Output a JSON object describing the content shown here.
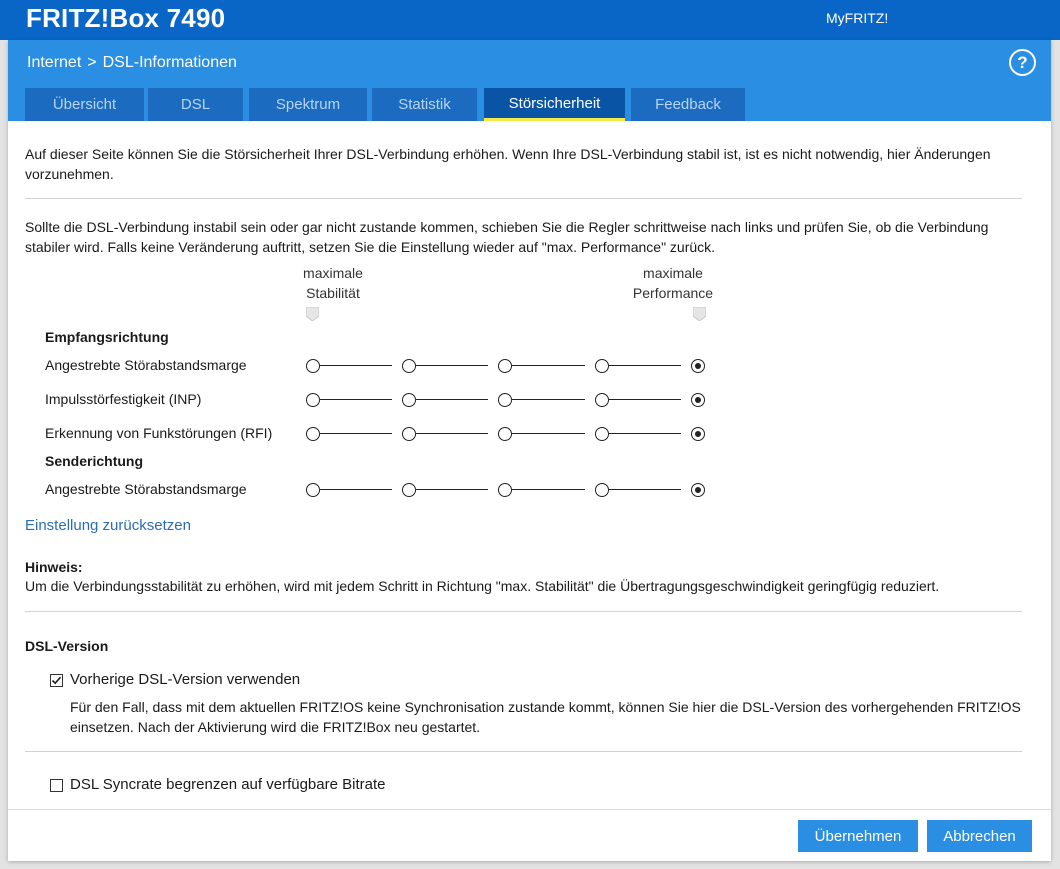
{
  "topbar": {
    "brand": "FRITZ!Box 7490",
    "myfritz": "MyFRITZ!"
  },
  "breadcrumb": {
    "parent": "Internet",
    "separator": ">",
    "current": "DSL-Informationen"
  },
  "help": {
    "icon": "help-icon",
    "glyph": "?"
  },
  "tabs": [
    {
      "label": "Übersicht",
      "active": false
    },
    {
      "label": "DSL",
      "active": false
    },
    {
      "label": "Spektrum",
      "active": false
    },
    {
      "label": "Statistik",
      "active": false
    },
    {
      "label": "Störsicherheit",
      "active": true
    },
    {
      "label": "Feedback",
      "active": false
    }
  ],
  "intro": {
    "text": "Auf dieser Seite können Sie die Störsicherheit Ihrer DSL-Verbindung erhöhen. Wenn Ihre DSL-Verbindung stabil ist, ist es nicht notwendig, hier Änderungen vorzunehmen."
  },
  "instructions": {
    "text": "Sollte die DSL-Verbindung instabil sein oder gar nicht zustande kommen, schieben Sie die Regler schrittweise nach links und prüfen Sie, ob die Verbindung stabiler wird. Falls keine Veränderung auftritt, setzen Sie die Einstellung wieder auf \"max. Performance\" zurück."
  },
  "columns": {
    "left_line1": "maximale",
    "left_line2": "Stabilität",
    "right_line1": "maximale",
    "right_line2": "Performance"
  },
  "sections": {
    "receive": "Empfangsrichtung",
    "send": "Senderichtung"
  },
  "sliders": [
    {
      "label": "Angestrebte Störabstandsmarge",
      "steps": 5,
      "selected": 5
    },
    {
      "label": "Impulsstörfestigkeit (INP)",
      "steps": 5,
      "selected": 5
    },
    {
      "label": "Erkennung von Funkstörungen (RFI)",
      "steps": 5,
      "selected": 5
    },
    {
      "label": "Angestrebte Störabstandsmarge",
      "steps": 5,
      "selected": 5
    }
  ],
  "reset_link": "Einstellung zurücksetzen",
  "note": {
    "title": "Hinweis:",
    "text": "Um die Verbindungsstabilität zu erhöhen, wird mit jedem Schritt in Richtung \"max. Stabilität\" die Übertragungsgeschwindigkeit geringfügig reduziert."
  },
  "dsl_version": {
    "title": "DSL-Version",
    "prev_checkbox_label": "Vorherige DSL-Version verwenden",
    "prev_checked": true,
    "prev_description": "Für den Fall, dass mit dem aktuellen FRITZ!OS keine Synchronisation zustande kommt, können Sie hier die DSL-Version des vorhergehenden FRITZ!OS einsetzen. Nach der Aktivierung wird die FRITZ!Box neu gestartet.",
    "syncrate_checkbox_label": "DSL Syncrate begrenzen auf verfügbare Bitrate",
    "syncrate_checked": false
  },
  "buttons": {
    "apply": "Übernehmen",
    "cancel": "Abbrechen"
  },
  "colors": {
    "topbar": "#0966c6",
    "header": "#2a8ee2",
    "tab": "#1b6cc0",
    "tab_active": "#0a54a6",
    "tab_indicator": "#f5e84a",
    "link": "#2a6db5"
  }
}
